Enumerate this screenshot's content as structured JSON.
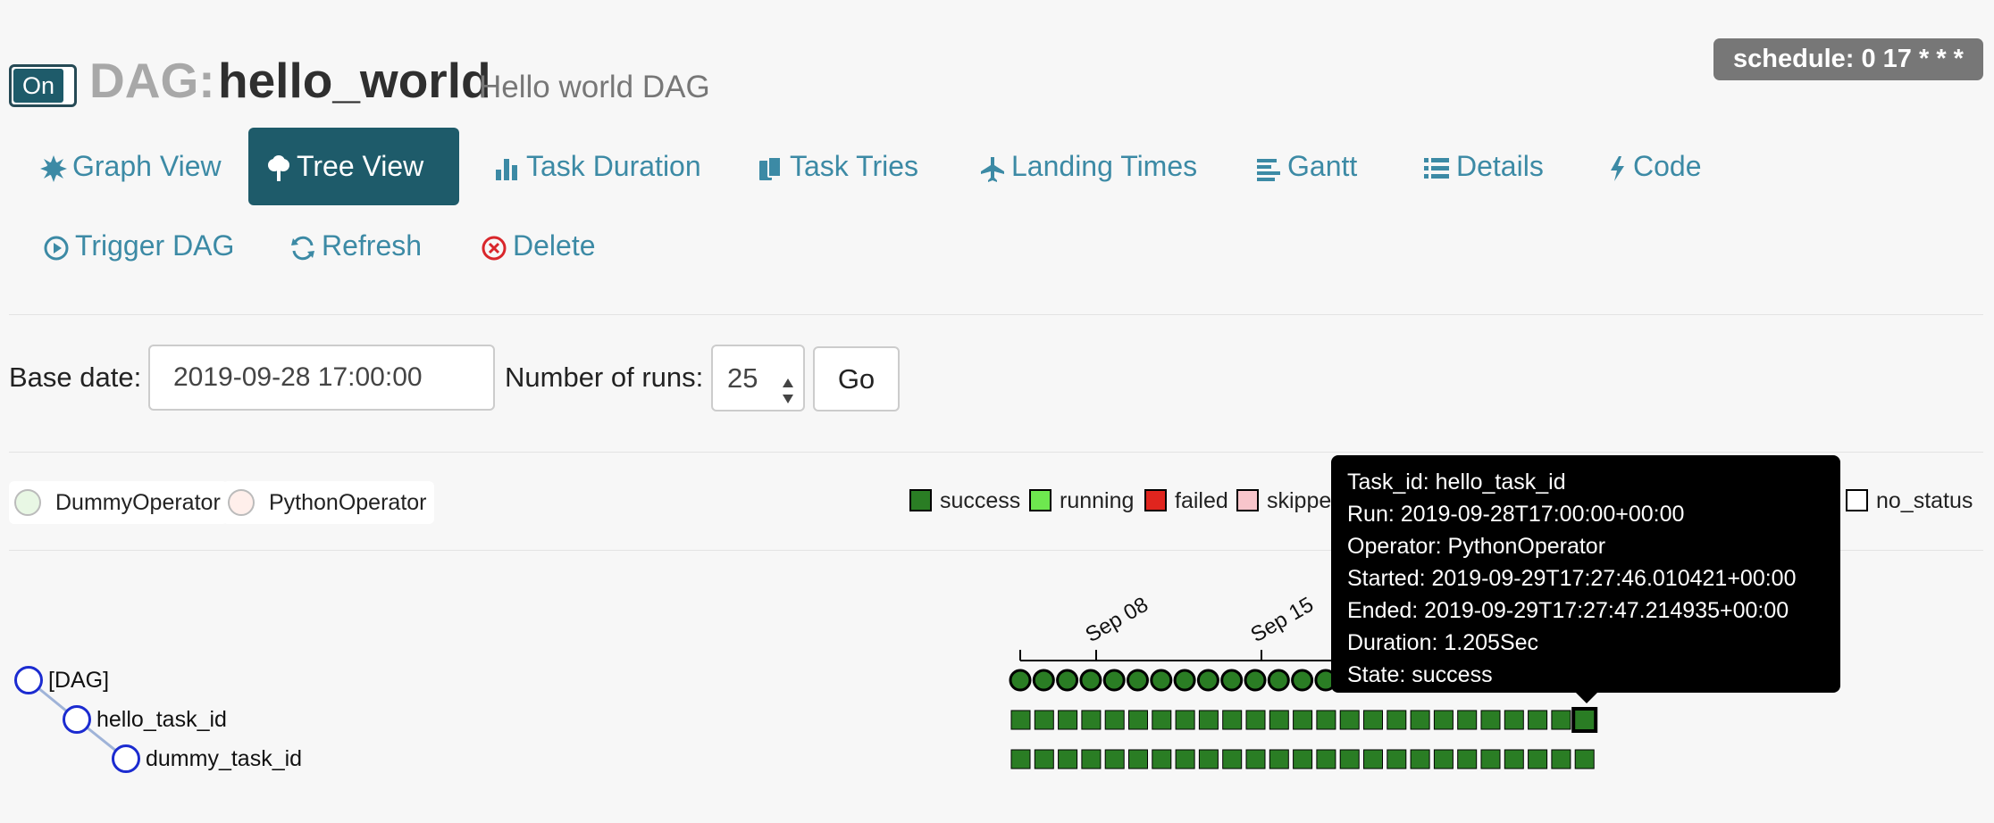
{
  "header": {
    "toggle_label": "On",
    "title_prefix": "DAG:",
    "dag_id": "hello_world",
    "description": "Hello world DAG",
    "schedule": "schedule: 0 17 * * *"
  },
  "nav": {
    "graph_view": "Graph View",
    "tree_view": "Tree View",
    "task_duration": "Task Duration",
    "task_tries": "Task Tries",
    "landing_times": "Landing Times",
    "gantt": "Gantt",
    "details": "Details",
    "code": "Code",
    "trigger_dag": "Trigger DAG",
    "refresh": "Refresh",
    "delete": "Delete"
  },
  "form": {
    "base_date_label": "Base date:",
    "base_date_value": "2019-09-28 17:00:00",
    "num_runs_label": "Number of runs:",
    "num_runs_value": "25",
    "go_label": "Go"
  },
  "operators": [
    {
      "name": "DummyOperator",
      "color": "#e8f7e4"
    },
    {
      "name": "PythonOperator",
      "color": "#ffefeb"
    }
  ],
  "status_legend": [
    {
      "label": "success",
      "color": "#2a7d24"
    },
    {
      "label": "running",
      "color": "#6ee84f"
    },
    {
      "label": "failed",
      "color": "#e0251e"
    },
    {
      "label": "skipped",
      "visible_text": "skippe",
      "color": "#f8c5cb"
    },
    {
      "label": "no_status",
      "color": "#ffffff"
    }
  ],
  "tree": {
    "nodes": [
      "[DAG]",
      "hello_task_id",
      "dummy_task_id"
    ],
    "axis_ticks": [
      "Sep 08",
      "Sep 15"
    ],
    "runs_visible": 25,
    "success_color": "#2a7d24"
  },
  "tooltip": {
    "lines": [
      "Task_id: hello_task_id",
      "Run: 2019-09-28T17:00:00+00:00",
      "Operator: PythonOperator",
      "Started: 2019-09-29T17:27:46.010421+00:00",
      "Ended: 2019-09-29T17:27:47.214935+00:00",
      "Duration: 1.205Sec",
      "State: success"
    ]
  }
}
